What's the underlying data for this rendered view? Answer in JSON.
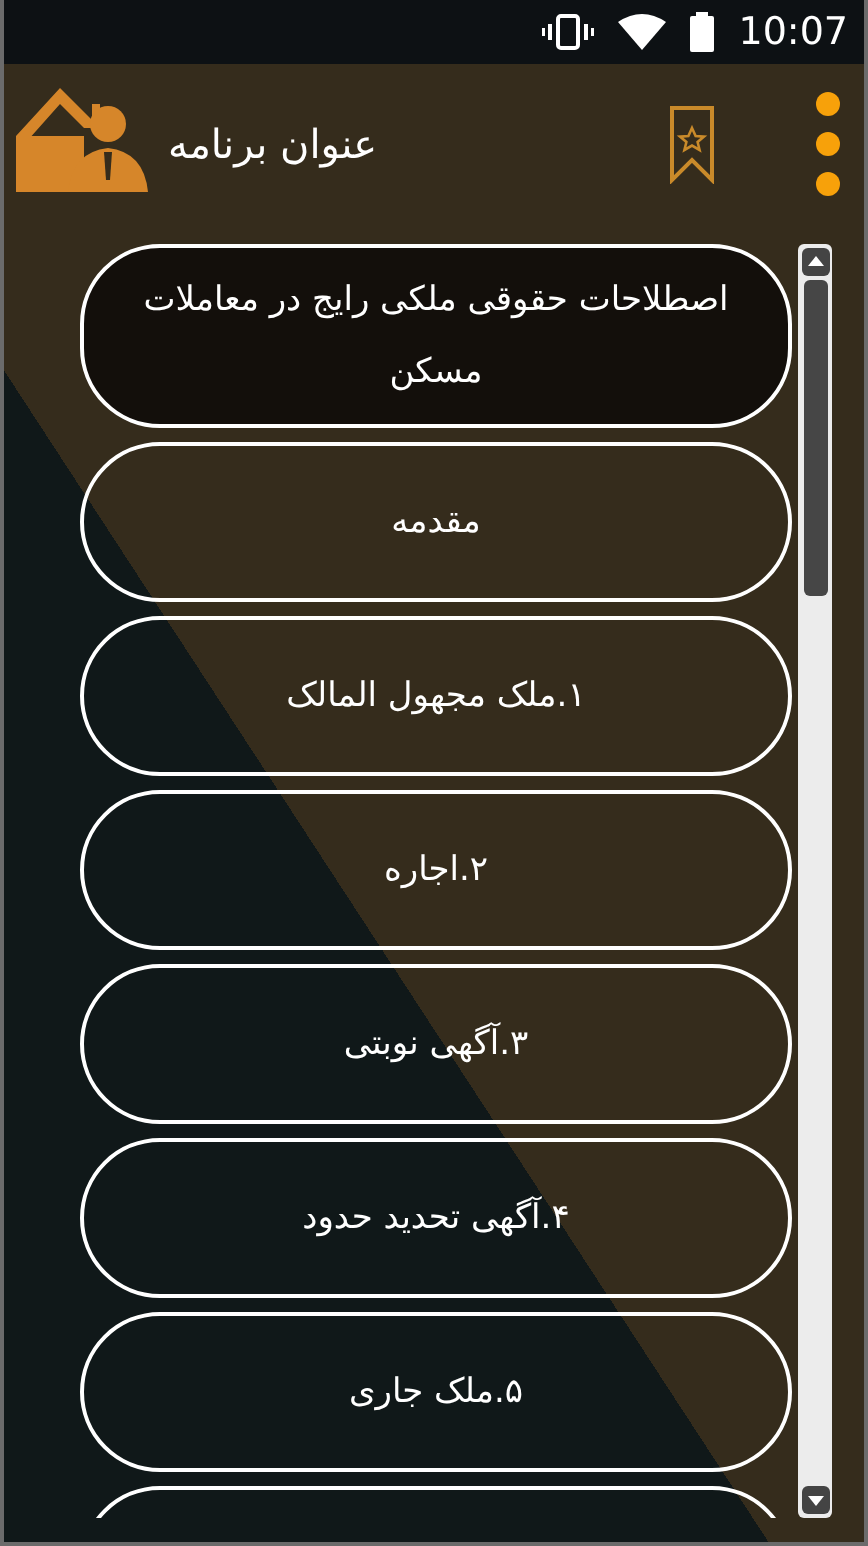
{
  "status_bar": {
    "time": "10:07"
  },
  "app_bar": {
    "title": "عنوان برنامه"
  },
  "items": [
    {
      "label": "اصطلاحات حقوقی ملکی رایج در معاملات مسکن",
      "selected": true
    },
    {
      "label": "مقدمه",
      "selected": false
    },
    {
      "label": "۱.ملک مجهول المالک",
      "selected": false
    },
    {
      "label": "۲.اجاره",
      "selected": false
    },
    {
      "label": "۳.آگهی نوبتی",
      "selected": false
    },
    {
      "label": "۴.آگهی تحدید حدود",
      "selected": false
    },
    {
      "label": "۵.ملک جاری",
      "selected": false
    }
  ]
}
